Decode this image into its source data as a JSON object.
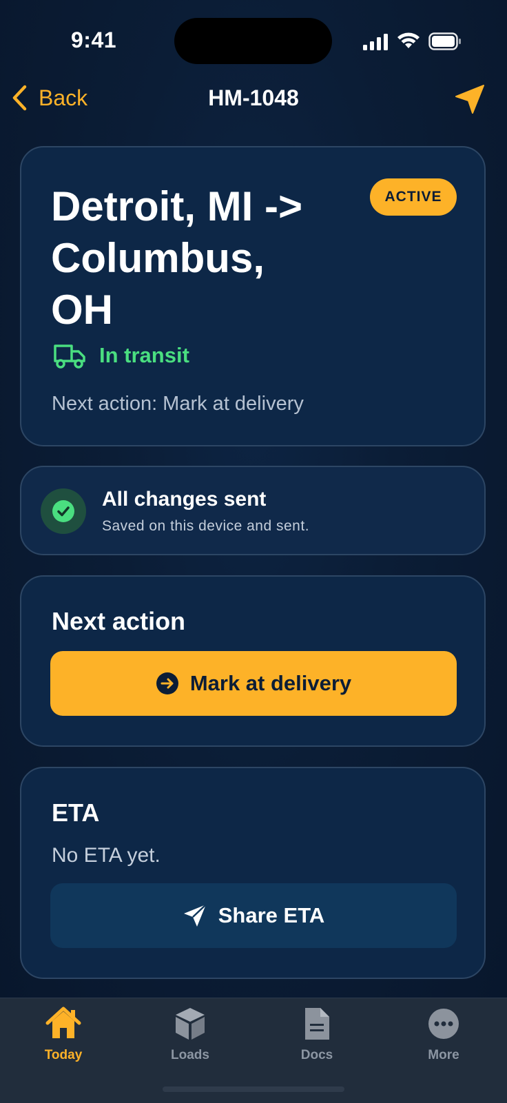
{
  "status_bar": {
    "time": "9:41"
  },
  "nav": {
    "back_label": "Back",
    "title": "HM-1048"
  },
  "route": {
    "title": "Detroit, MI -> Columbus, OH",
    "badge": "ACTIVE",
    "status": "In transit",
    "next_action_text": "Next action: Mark at delivery"
  },
  "sync": {
    "title": "All changes sent",
    "subtitle": "Saved on this device and sent."
  },
  "next_action": {
    "heading": "Next action",
    "button_label": "Mark at delivery"
  },
  "eta": {
    "heading": "ETA",
    "text": "No ETA yet.",
    "button_label": "Share ETA"
  },
  "tabs": [
    {
      "label": "Today",
      "icon": "home-icon",
      "active": true
    },
    {
      "label": "Loads",
      "icon": "box-icon",
      "active": false
    },
    {
      "label": "Docs",
      "icon": "document-icon",
      "active": false
    },
    {
      "label": "More",
      "icon": "more-icon",
      "active": false
    }
  ],
  "colors": {
    "accent": "#fdb228",
    "success": "#4ade80",
    "background": "#0b1d36",
    "card": "#0d2747"
  }
}
